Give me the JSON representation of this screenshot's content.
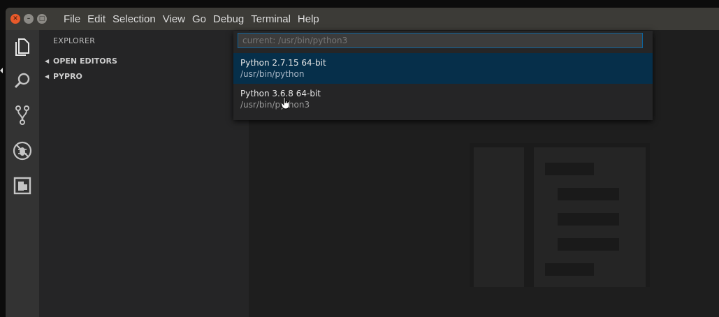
{
  "titlebar": {
    "window_buttons": [
      "close-icon",
      "minimize-icon",
      "maximize-icon"
    ],
    "menu": [
      "File",
      "Edit",
      "Selection",
      "View",
      "Go",
      "Debug",
      "Terminal",
      "Help"
    ]
  },
  "activitybar": {
    "icons": [
      "files-icon",
      "search-icon",
      "source-control-icon",
      "debug-icon",
      "extensions-icon"
    ]
  },
  "sidebar": {
    "title": "EXPLORER",
    "sections": [
      {
        "label": "OPEN EDITORS",
        "expanded": false
      },
      {
        "label": "PYPRO",
        "expanded": false
      }
    ]
  },
  "quick_pick": {
    "input_value": "",
    "placeholder": "current: /usr/bin/python3",
    "items": [
      {
        "label": "Python 2.7.15 64-bit",
        "description": "/usr/bin/python",
        "selected": true
      },
      {
        "label": "Python 3.6.8 64-bit",
        "description": "/usr/bin/python3",
        "selected": false
      }
    ]
  },
  "colors": {
    "accent": "#0e639c",
    "selection": "#062f4a",
    "close_button": "#e95a2a"
  }
}
